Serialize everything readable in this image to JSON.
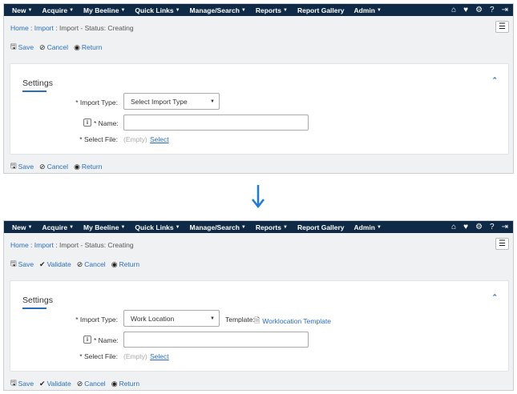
{
  "nav": {
    "items": [
      "New",
      "Acquire",
      "My Beeline",
      "Quick Links",
      "Manage/Search",
      "Reports",
      "Report Gallery",
      "Admin"
    ],
    "dropdown_flags": [
      true,
      true,
      true,
      true,
      true,
      true,
      false,
      true
    ],
    "right_icons": [
      "home-icon",
      "heart-icon",
      "gear-icon",
      "help-icon",
      "logout-icon"
    ]
  },
  "breadcrumb": {
    "home": "Home",
    "import": "Import",
    "current": "Import - Status: Creating"
  },
  "before": {
    "toolbar": {
      "save": "Save",
      "cancel": "Cancel",
      "return": "Return"
    },
    "settings": {
      "title": "Settings",
      "import_type_label": "* Import Type:",
      "import_type_value": "Select Import Type",
      "name_label": "* Name:",
      "name_value": "",
      "select_file_label": "* Select File:",
      "file_value": "(Empty)",
      "select_link": "Select"
    }
  },
  "after": {
    "toolbar": {
      "save": "Save",
      "validate": "Validate",
      "cancel": "Cancel",
      "return": "Return"
    },
    "settings": {
      "title": "Settings",
      "import_type_label": "* Import Type:",
      "import_type_value": "Work Location",
      "template_label": "Template:",
      "template_link": "Worklocation Template",
      "name_label": "* Name:",
      "name_value": "",
      "select_file_label": "* Select File:",
      "file_value": "(Empty)",
      "select_link": "Select"
    }
  },
  "colors": {
    "navbar": "#0f2a47",
    "link": "#2a6ebb",
    "arrow": "#1f7ad6",
    "background": "#f0f1f2"
  }
}
